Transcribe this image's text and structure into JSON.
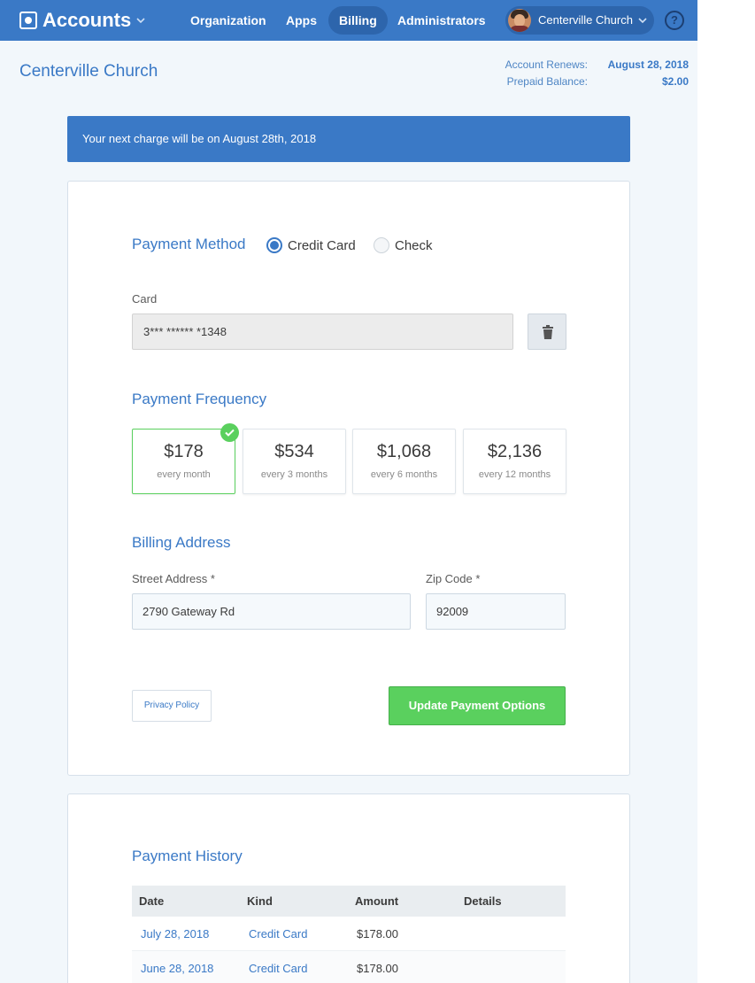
{
  "nav": {
    "brand": "Accounts",
    "items": [
      {
        "label": "Organization",
        "active": false
      },
      {
        "label": "Apps",
        "active": false
      },
      {
        "label": "Billing",
        "active": true
      },
      {
        "label": "Administrators",
        "active": false
      }
    ],
    "org_switcher": "Centerville Church",
    "help": "?"
  },
  "header": {
    "title": "Centerville Church",
    "renews_label": "Account Renews:",
    "renews_value": "August 28, 2018",
    "balance_label": "Prepaid Balance:",
    "balance_value": "$2.00"
  },
  "banner": "Your next charge will be on August 28th, 2018",
  "payment": {
    "method_title": "Payment Method",
    "methods": [
      {
        "label": "Credit Card",
        "selected": true
      },
      {
        "label": "Check",
        "selected": false
      }
    ],
    "card_label": "Card",
    "card_value": "3*** ****** *1348",
    "frequency_title": "Payment Frequency",
    "frequencies": [
      {
        "amount": "$178",
        "period": "every month",
        "selected": true
      },
      {
        "amount": "$534",
        "period": "every 3 months",
        "selected": false
      },
      {
        "amount": "$1,068",
        "period": "every 6 months",
        "selected": false
      },
      {
        "amount": "$2,136",
        "period": "every 12 months",
        "selected": false
      }
    ],
    "address_title": "Billing Address",
    "street_label": "Street Address *",
    "street_value": "2790 Gateway Rd",
    "zip_label": "Zip Code *",
    "zip_value": "92009",
    "privacy_button": "Privacy Policy",
    "update_button": "Update Payment Options"
  },
  "history": {
    "title": "Payment History",
    "columns": [
      "Date",
      "Kind",
      "Amount",
      "Details"
    ],
    "rows": [
      {
        "date": "July 28, 2018",
        "kind": "Credit Card",
        "amount": "$178.00",
        "details": ""
      },
      {
        "date": "June 28, 2018",
        "kind": "Credit Card",
        "amount": "$178.00",
        "details": ""
      }
    ]
  },
  "colors": {
    "primary": "#3a79c6",
    "success": "#5ad05e",
    "background": "#f2f7fb"
  }
}
